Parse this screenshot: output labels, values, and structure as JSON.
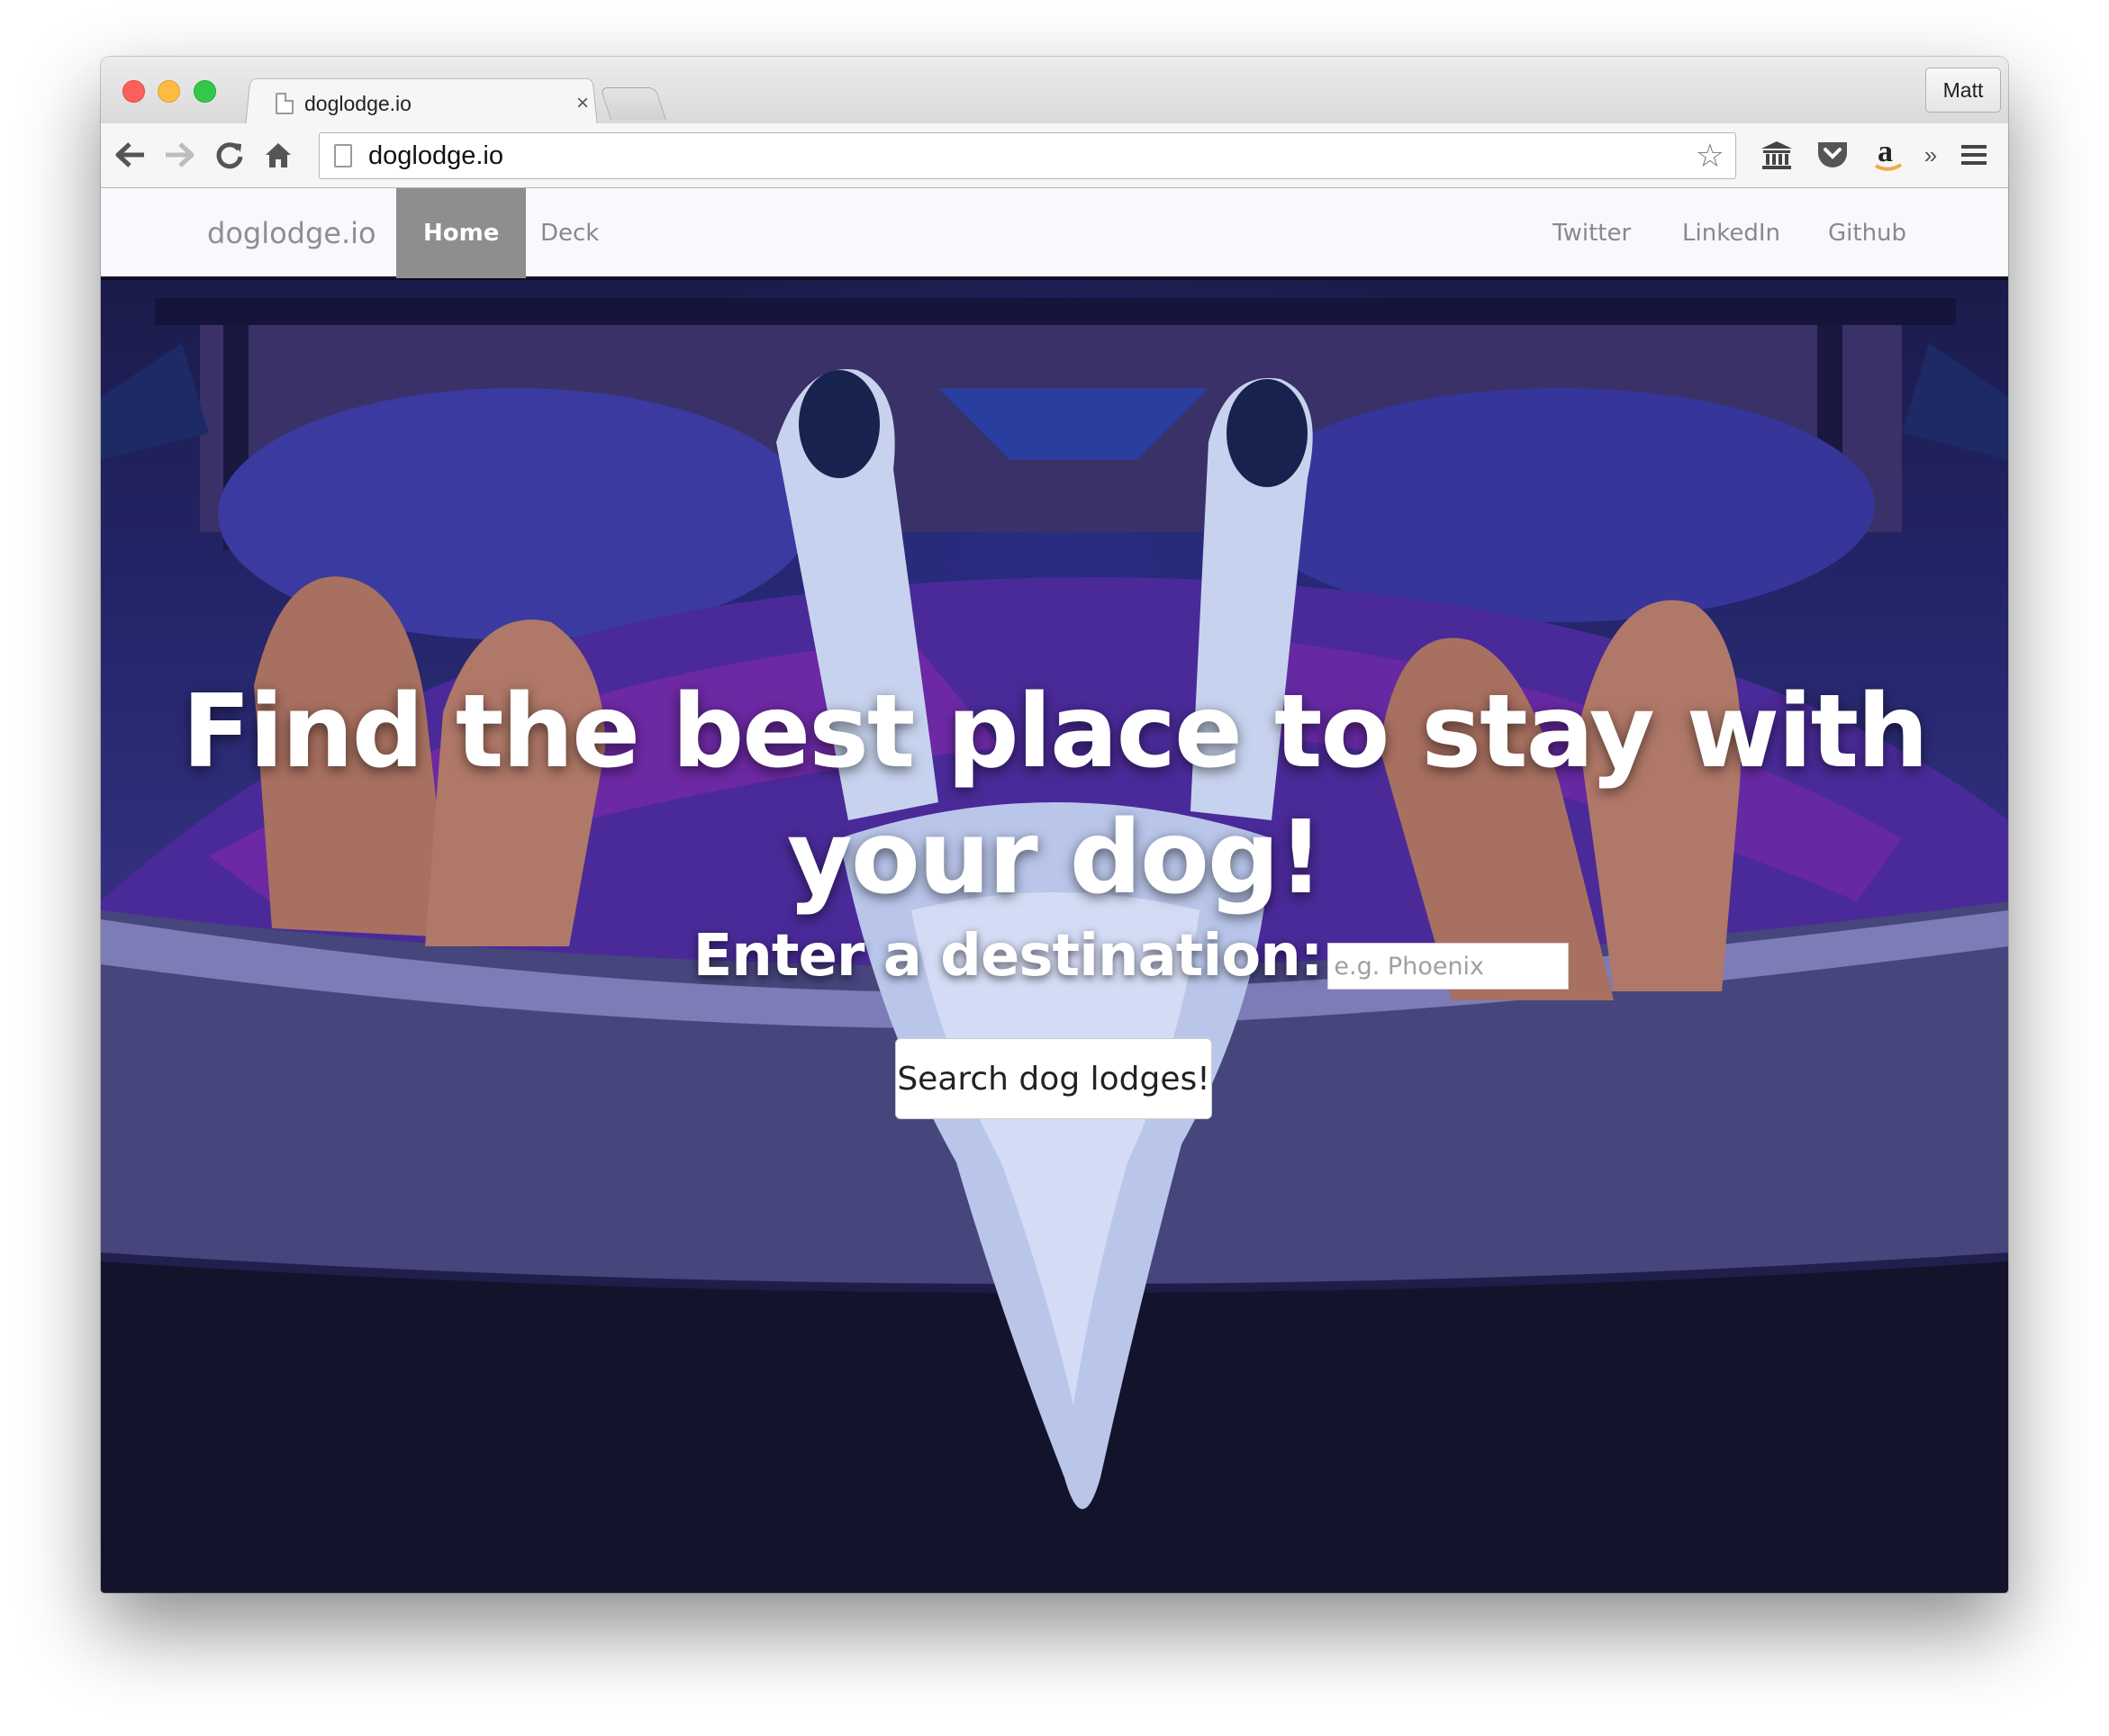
{
  "browser": {
    "tab_title": "doglodge.io",
    "tab_close": "×",
    "profile_name": "Matt",
    "url": "doglodge.io",
    "overflow_label": "»"
  },
  "site": {
    "brand": "doglodge.io",
    "nav_left": [
      "Home",
      "Deck"
    ],
    "nav_right": [
      "Twitter",
      "LinkedIn",
      "Github"
    ],
    "active_item": "Home"
  },
  "hero": {
    "title": "Find the best place to stay with your dog!",
    "destination_label": "Enter a destination:",
    "destination_placeholder": "e.g. Phoenix",
    "destination_value": "",
    "search_button": "Search dog lodges!"
  },
  "icons": {
    "back": "arrow-left-icon",
    "forward": "arrow-right-icon",
    "reload": "reload-icon",
    "home": "home-icon",
    "bookmark": "star-icon",
    "ext1": "bank-icon",
    "ext2": "pocket-icon",
    "ext3": "amazon-icon",
    "menu": "hamburger-menu-icon"
  },
  "colors": {
    "nav_active_bg": "#8e8e8e",
    "nav_bg": "#f8f8fd",
    "hero_tint": "#2a2c82"
  }
}
